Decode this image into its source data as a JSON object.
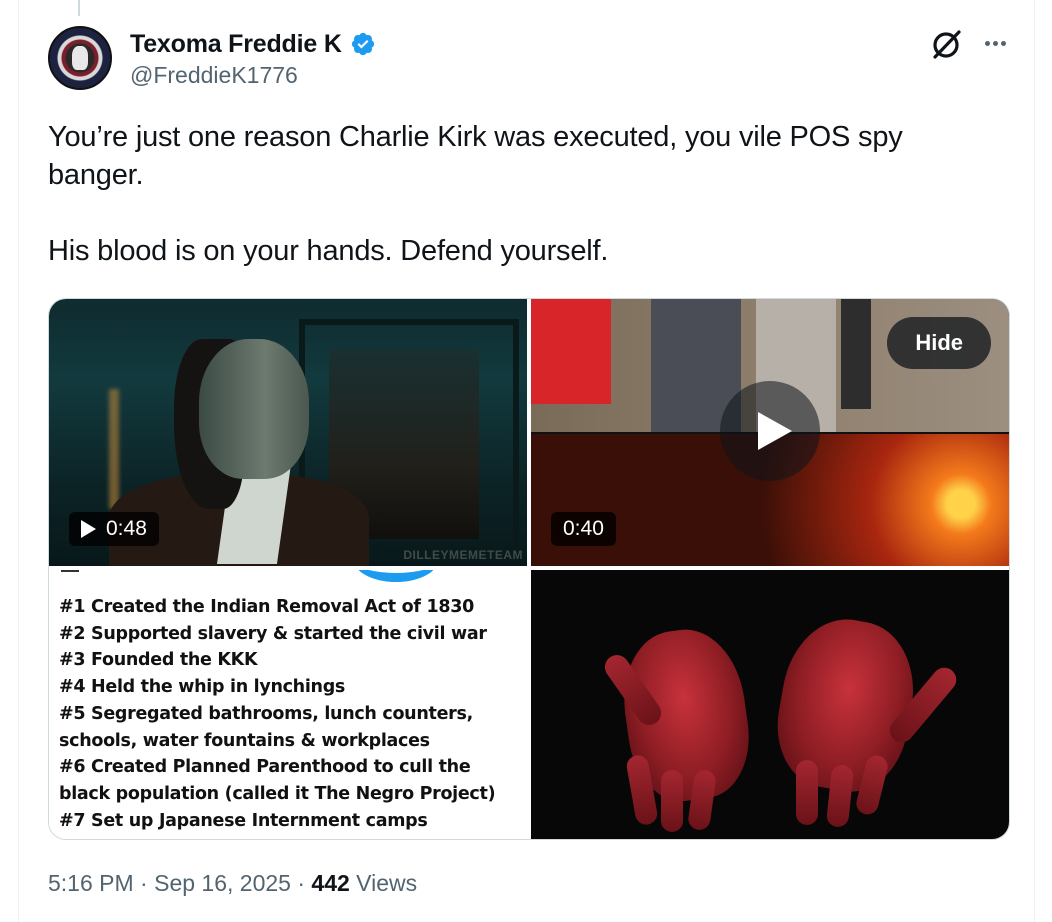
{
  "author": {
    "display_name": "Texoma Freddie K",
    "handle": "@FreddieK1776",
    "verified_color": "#1d9bf0"
  },
  "actions": {
    "grok_icon": "grok-icon",
    "more_icon": "more-icon"
  },
  "tweet": {
    "paragraphs": [
      "You’re just one reason Charlie Kirk was executed, you vile POS spy banger.",
      "His blood is on your hands. Defend yourself."
    ]
  },
  "media": {
    "video1": {
      "duration": "0:48",
      "watermark": "DILLEYMEMETEAM"
    },
    "video2": {
      "duration": "0:40",
      "hide_label": "Hide"
    },
    "image_list": [
      "#1 Created the Indian Removal Act of 1830",
      "#2 Supported slavery & started the civil war",
      "#3 Founded the KKK",
      "#4 Held the whip in lynchings",
      "#5 Segregated bathrooms, lunch counters,",
      "schools, water fountains & workplaces",
      "#6 Created Planned Parenthood to cull the",
      "black population (called it The Negro Project)",
      "#7 Set up Japanese Internment camps"
    ]
  },
  "meta": {
    "time": "5:16 PM",
    "date": "Sep 16, 2025",
    "views_count": "442",
    "views_label": "Views",
    "separator": "·"
  }
}
